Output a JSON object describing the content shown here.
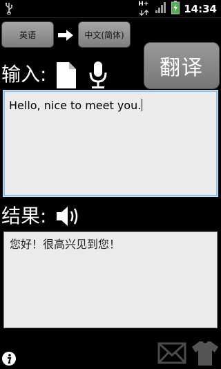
{
  "status_bar": {
    "time": "14:34",
    "network": "H+"
  },
  "languages": {
    "source": "英语",
    "target": "中文(简体)"
  },
  "translate_button": "翻译",
  "input_label": "输入:",
  "input_text": "Hello, nice to meet you.",
  "result_label": "结果:",
  "result_text": "您好！很高兴见到您！",
  "icons": [
    "usb-icon",
    "network-icon",
    "signal-icon",
    "battery-icon",
    "arrow-right-icon",
    "document-icon",
    "microphone-icon",
    "speaker-icon",
    "info-icon",
    "mail-icon",
    "tshirt-icon"
  ]
}
